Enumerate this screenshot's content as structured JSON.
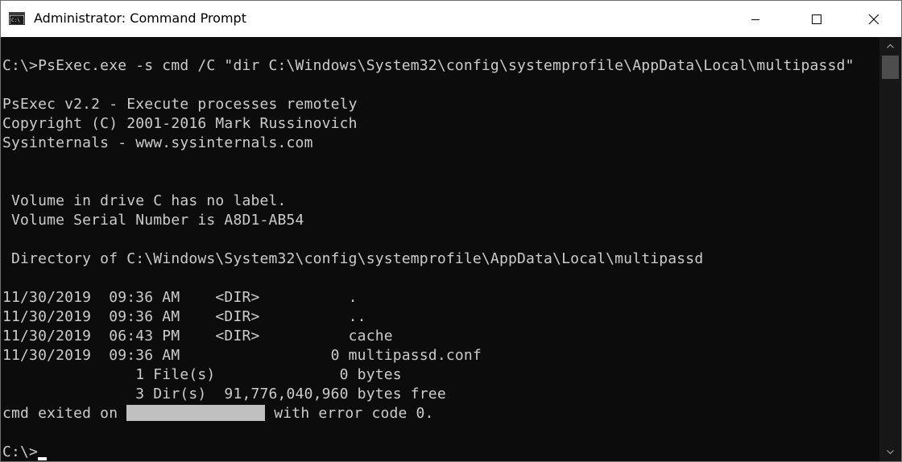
{
  "window": {
    "title": "Administrator: Command Prompt",
    "app_icon": "command-prompt-icon",
    "controls": {
      "minimize_icon": "minimize-icon",
      "maximize_icon": "maximize-icon",
      "close_icon": "close-icon"
    }
  },
  "colors": {
    "console_bg": "#0c0c0c",
    "console_fg": "#cccccc",
    "titlebar_bg": "#ffffff",
    "redaction": "#c0c0c0"
  },
  "console": {
    "command": "C:\\>PsExec.exe -s cmd /C \"dir C:\\Windows\\System32\\config\\systemprofile\\AppData\\Local\\multipassd\"",
    "banner": [
      "PsExec v2.2 - Execute processes remotely",
      "Copyright (C) 2001-2016 Mark Russinovich",
      "Sysinternals - www.sysinternals.com"
    ],
    "volume_label": " Volume in drive C has no label.",
    "volume_serial": " Volume Serial Number is A8D1-AB54",
    "directory_of": " Directory of C:\\Windows\\System32\\config\\systemprofile\\AppData\\Local\\multipassd",
    "listing": [
      "11/30/2019  09:36 AM    <DIR>          .",
      "11/30/2019  09:36 AM    <DIR>          ..",
      "11/30/2019  06:43 PM    <DIR>          cache",
      "11/30/2019  09:36 AM                 0 multipassd.conf"
    ],
    "summary_files": "               1 File(s)              0 bytes",
    "summary_dirs": "               3 Dir(s)  91,776,040,960 bytes free",
    "exit_prefix": "cmd exited on ",
    "exit_suffix": " with error code 0.",
    "prompt": "C:\\>"
  }
}
